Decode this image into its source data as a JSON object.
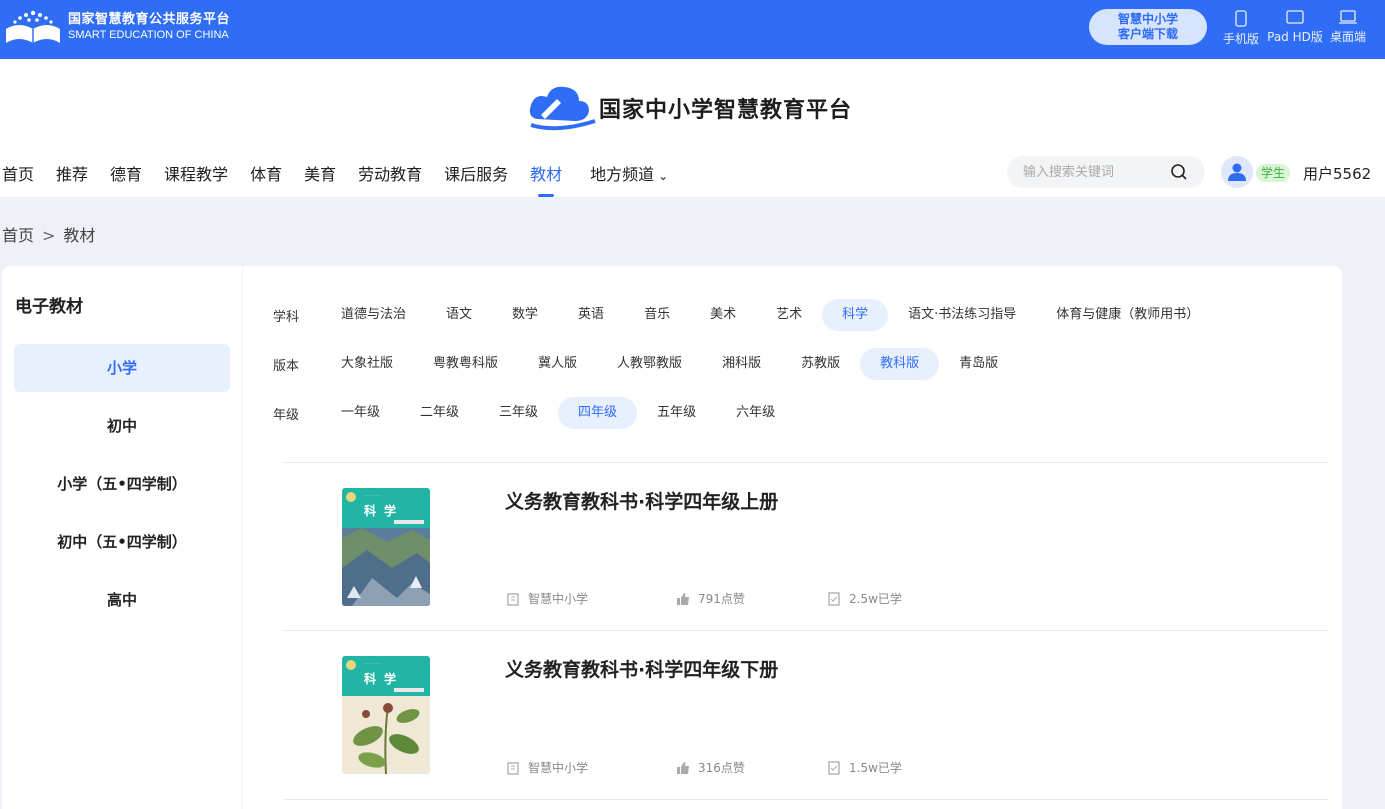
{
  "topbar": {
    "brand_cn": "国家智慧教育公共服务平台",
    "brand_en": "SMART EDUCATION OF CHINA",
    "download_line1": "智慧中小学",
    "download_line2": "客户端下载",
    "devices": [
      {
        "label": "手机版",
        "icon": "phone-icon"
      },
      {
        "label": "Pad HD版",
        "icon": "tablet-icon"
      },
      {
        "label": "桌面端",
        "icon": "laptop-icon"
      }
    ]
  },
  "header": {
    "logo_text": "国家中小学智慧教育平台",
    "nav": [
      {
        "label": "首页"
      },
      {
        "label": "推荐"
      },
      {
        "label": "德育"
      },
      {
        "label": "课程教学"
      },
      {
        "label": "体育"
      },
      {
        "label": "美育"
      },
      {
        "label": "劳动教育"
      },
      {
        "label": "课后服务"
      },
      {
        "label": "教材",
        "active": true
      },
      {
        "label": "地方频道",
        "dropdown": true
      }
    ],
    "search_placeholder": "输入搜索关键词",
    "role_badge": "学生",
    "username": "用户5562"
  },
  "breadcrumb": {
    "home": "首页",
    "sep": ">",
    "current": "教材"
  },
  "sidebar": {
    "title": "电子教材",
    "items": [
      "小学",
      "初中",
      "小学（五•四学制）",
      "初中（五•四学制）",
      "高中"
    ],
    "active_index": 0
  },
  "filters": {
    "subject": {
      "label": "学科",
      "options": [
        "道德与法治",
        "语文",
        "数学",
        "英语",
        "音乐",
        "美术",
        "艺术",
        "科学",
        "语文·书法练习指导",
        "体育与健康（教师用书）"
      ],
      "active": "科学"
    },
    "edition": {
      "label": "版本",
      "options": [
        "大象社版",
        "粤教粤科版",
        "冀人版",
        "人教鄂教版",
        "湘科版",
        "苏教版",
        "教科版",
        "青岛版"
      ],
      "active": "教科版"
    },
    "grade": {
      "label": "年级",
      "options": [
        "一年级",
        "二年级",
        "三年级",
        "四年级",
        "五年级",
        "六年级"
      ],
      "active": "四年级"
    }
  },
  "books": [
    {
      "title": "义务教育教科书·科学四年级上册",
      "cover_title": "科学",
      "publisher": "智慧中小学",
      "likes": "791点赞",
      "learners": "2.5w已学"
    },
    {
      "title": "义务教育教科书·科学四年级下册",
      "cover_title": "科学",
      "publisher": "智慧中小学",
      "likes": "316点赞",
      "learners": "1.5w已学"
    }
  ],
  "colors": {
    "primary": "#2f6df5",
    "topbar": "#2f6df5",
    "active_bg": "#e9f0fd",
    "cover_teal": "#22b5a5"
  }
}
